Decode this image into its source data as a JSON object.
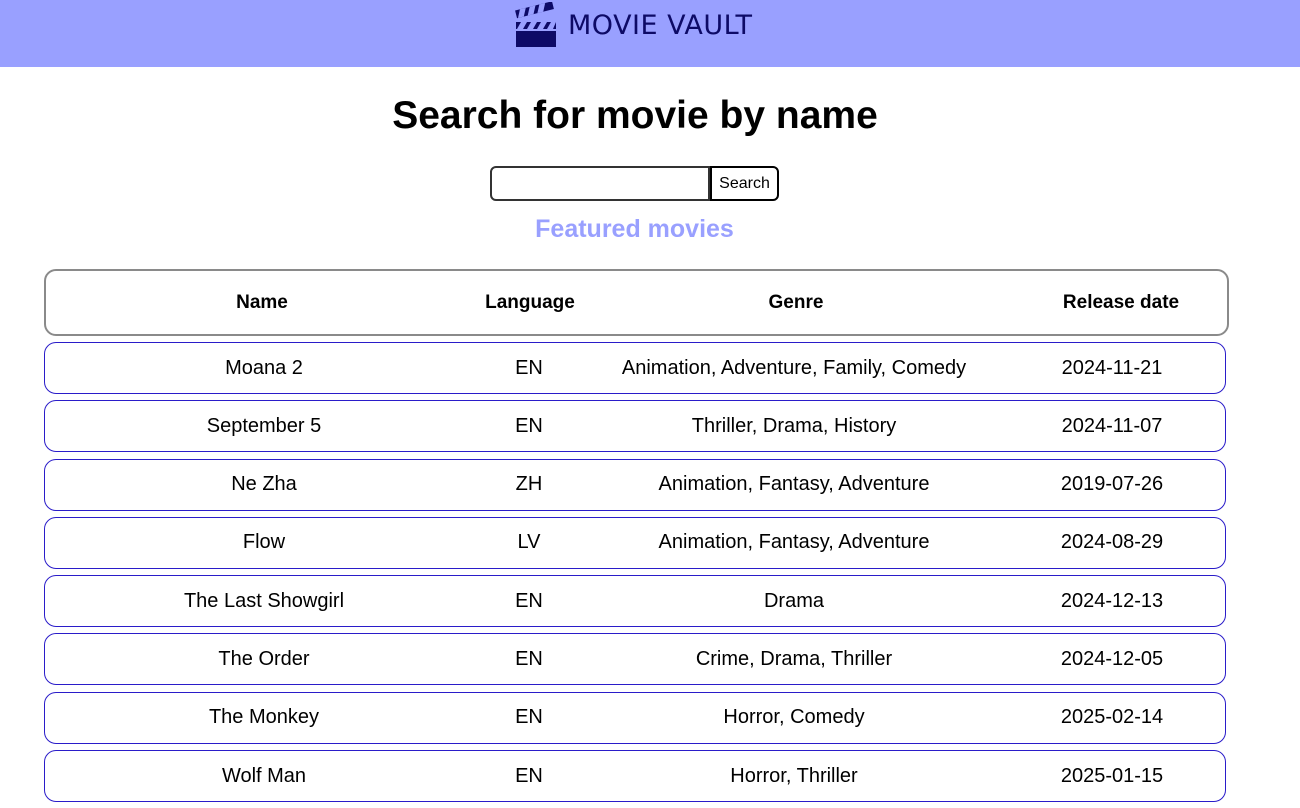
{
  "header": {
    "logo_icon": "clapperboard-icon",
    "brand_name": "MOVIE VAULT",
    "bg_color": "#99a0ff",
    "brand_color": "#0d0a66"
  },
  "main": {
    "title": "Search for movie by name",
    "search": {
      "value": "",
      "placeholder": "",
      "button_label": "Search"
    },
    "featured_title": "Featured movies",
    "accent_color": "#99a0ff"
  },
  "table": {
    "columns": [
      "Name",
      "Language",
      "Genre",
      "Release date"
    ],
    "rows": [
      {
        "name": "Moana 2",
        "language": "EN",
        "genre": "Animation, Adventure, Family, Comedy",
        "release_date": "2024-11-21"
      },
      {
        "name": "September 5",
        "language": "EN",
        "genre": "Thriller, Drama, History",
        "release_date": "2024-11-07"
      },
      {
        "name": "Ne Zha",
        "language": "ZH",
        "genre": "Animation, Fantasy, Adventure",
        "release_date": "2019-07-26"
      },
      {
        "name": "Flow",
        "language": "LV",
        "genre": "Animation, Fantasy, Adventure",
        "release_date": "2024-08-29"
      },
      {
        "name": "The Last Showgirl",
        "language": "EN",
        "genre": "Drama",
        "release_date": "2024-12-13"
      },
      {
        "name": "The Order",
        "language": "EN",
        "genre": "Crime, Drama, Thriller",
        "release_date": "2024-12-05"
      },
      {
        "name": "The Monkey",
        "language": "EN",
        "genre": "Horror, Comedy",
        "release_date": "2025-02-14"
      },
      {
        "name": "Wolf Man",
        "language": "EN",
        "genre": "Horror, Thriller",
        "release_date": "2025-01-15"
      }
    ],
    "row_border_color": "#2a1cc9"
  }
}
